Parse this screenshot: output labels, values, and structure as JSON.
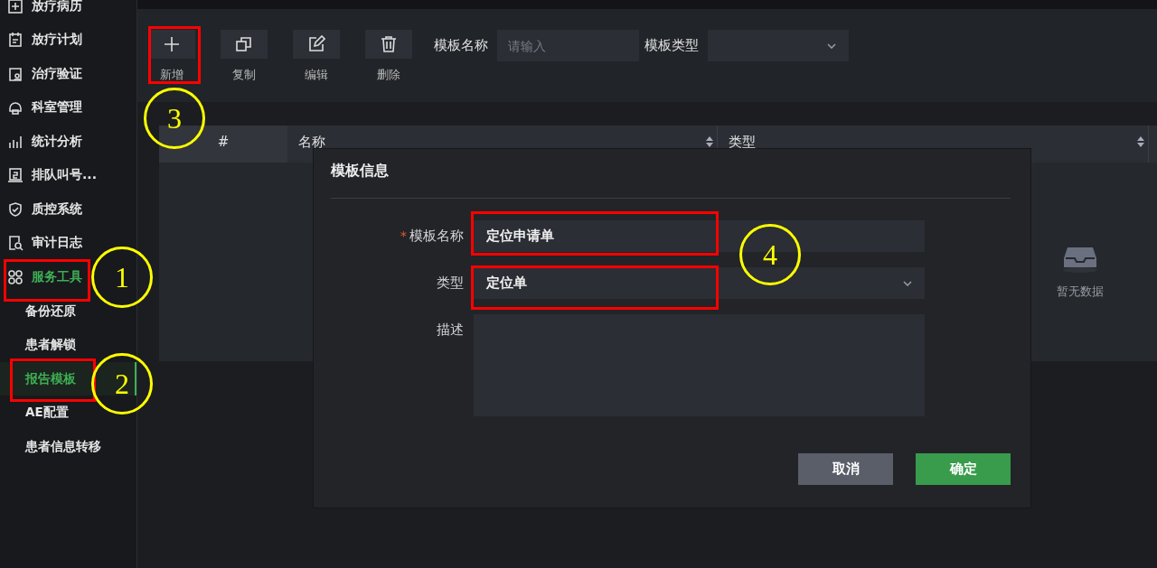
{
  "sidebar": {
    "items": [
      {
        "label": "放疗病历",
        "selected": false
      },
      {
        "label": "放疗计划",
        "selected": false
      },
      {
        "label": "治疗验证",
        "selected": false
      },
      {
        "label": "科室管理",
        "selected": false
      },
      {
        "label": "统计分析",
        "selected": false
      },
      {
        "label": "排队叫号...",
        "selected": false
      },
      {
        "label": "质控系统",
        "selected": false
      },
      {
        "label": "审计日志",
        "selected": false
      },
      {
        "label": "服务工具",
        "selected": true,
        "expanded": true,
        "children": [
          {
            "label": "备份还原",
            "selected": false
          },
          {
            "label": "患者解锁",
            "selected": false
          },
          {
            "label": "报告模板",
            "selected": true
          },
          {
            "label": "AE配置",
            "selected": false
          },
          {
            "label": "患者信息转移",
            "selected": false
          }
        ]
      }
    ]
  },
  "toolbar": {
    "buttons": [
      {
        "label": "新增"
      },
      {
        "label": "复制"
      },
      {
        "label": "编辑"
      },
      {
        "label": "删除"
      }
    ],
    "filters": [
      {
        "label": "模板名称",
        "kind": "input",
        "placeholder": "请输入"
      },
      {
        "label": "模板类型",
        "kind": "select"
      }
    ]
  },
  "table": {
    "columns": [
      {
        "label": "#",
        "sortable": false
      },
      {
        "label": "名称",
        "sortable": true
      },
      {
        "label": "类型",
        "sortable": true
      }
    ],
    "empty_text": "暂无数据"
  },
  "dialog": {
    "title": "模板信息",
    "required_mark": "*",
    "fields": [
      {
        "label": "模板名称",
        "required": true,
        "kind": "input",
        "value": "定位申请单"
      },
      {
        "label": "类型",
        "required": false,
        "kind": "select",
        "value": "定位单"
      },
      {
        "label": "描述",
        "required": false,
        "kind": "textarea"
      }
    ],
    "buttons": [
      {
        "label": "取消",
        "kind": "secondary"
      },
      {
        "label": "确定",
        "kind": "primary"
      }
    ]
  },
  "annotations": [
    "1",
    "2",
    "3",
    "4"
  ]
}
